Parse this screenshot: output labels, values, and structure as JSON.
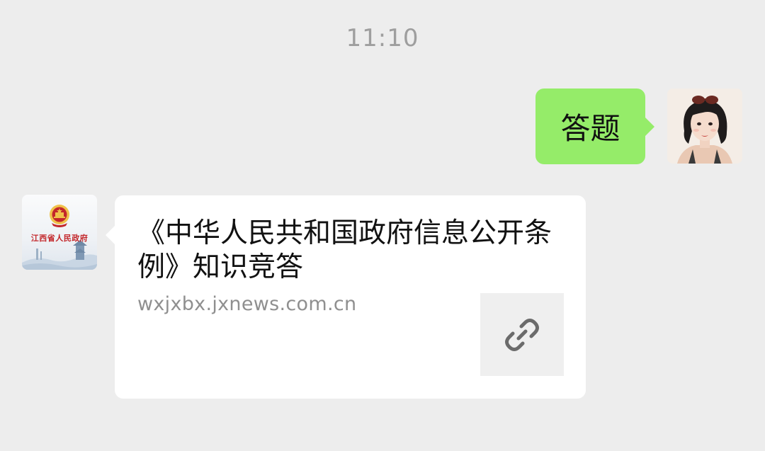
{
  "chat": {
    "timestamp": "11:10",
    "messages": [
      {
        "direction": "outgoing",
        "type": "text",
        "text": "答题",
        "bubble_color": "#95ec69"
      },
      {
        "direction": "incoming",
        "type": "link-card",
        "title": "《中华人民共和国政府信息公开条例》知识竞答",
        "url": "wxjxbx.jxnews.com.cn",
        "thumb_icon": "link-icon"
      }
    ]
  },
  "contacts": {
    "sender_avatar_label": "江西省人民政府",
    "sender_avatar_icon": "national-emblem-icon",
    "me_avatar_icon": "user-avatar"
  },
  "colors": {
    "background": "#ededed",
    "outgoing_bubble": "#95ec69",
    "incoming_bubble": "#ffffff",
    "timestamp_text": "#9e9e9e",
    "url_text": "#8f8f8f",
    "emblem_red": "#c3272b",
    "emblem_gold": "#f0c24b"
  }
}
